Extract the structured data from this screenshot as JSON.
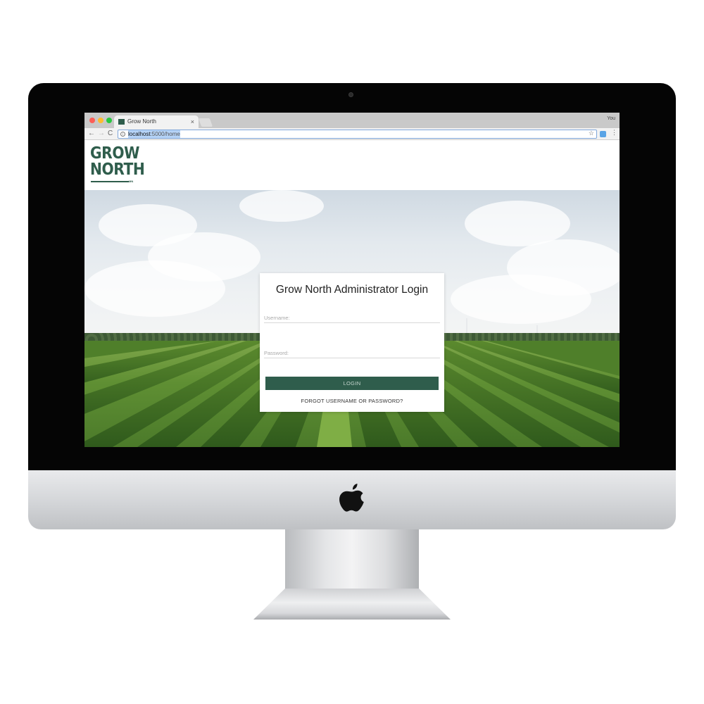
{
  "browser": {
    "tab_title": "Grow North",
    "tab_close": "×",
    "profile": "You",
    "url_host": "localhost",
    "url_path": ":5000/home",
    "nav_back": "←",
    "nav_forward": "→",
    "nav_reload": "C",
    "star": "☆",
    "menu": "⋮"
  },
  "header": {
    "logo_line1": "GROW",
    "logo_line2": "NORTH",
    "logo_sub": "MN"
  },
  "login": {
    "title": "Grow North Administrator Login",
    "username_label": "Username:",
    "password_label": "Password:",
    "login_button": "LOGIN",
    "forgot_link": "FORGOT USERNAME OR PASSWORD?"
  },
  "colors": {
    "brand_green": "#2f5d4c",
    "bezel": "#050505"
  },
  "icons": [
    "apple-logo-icon",
    "info-icon",
    "star-icon",
    "extension-icon",
    "menu-icon",
    "close-icon"
  ]
}
